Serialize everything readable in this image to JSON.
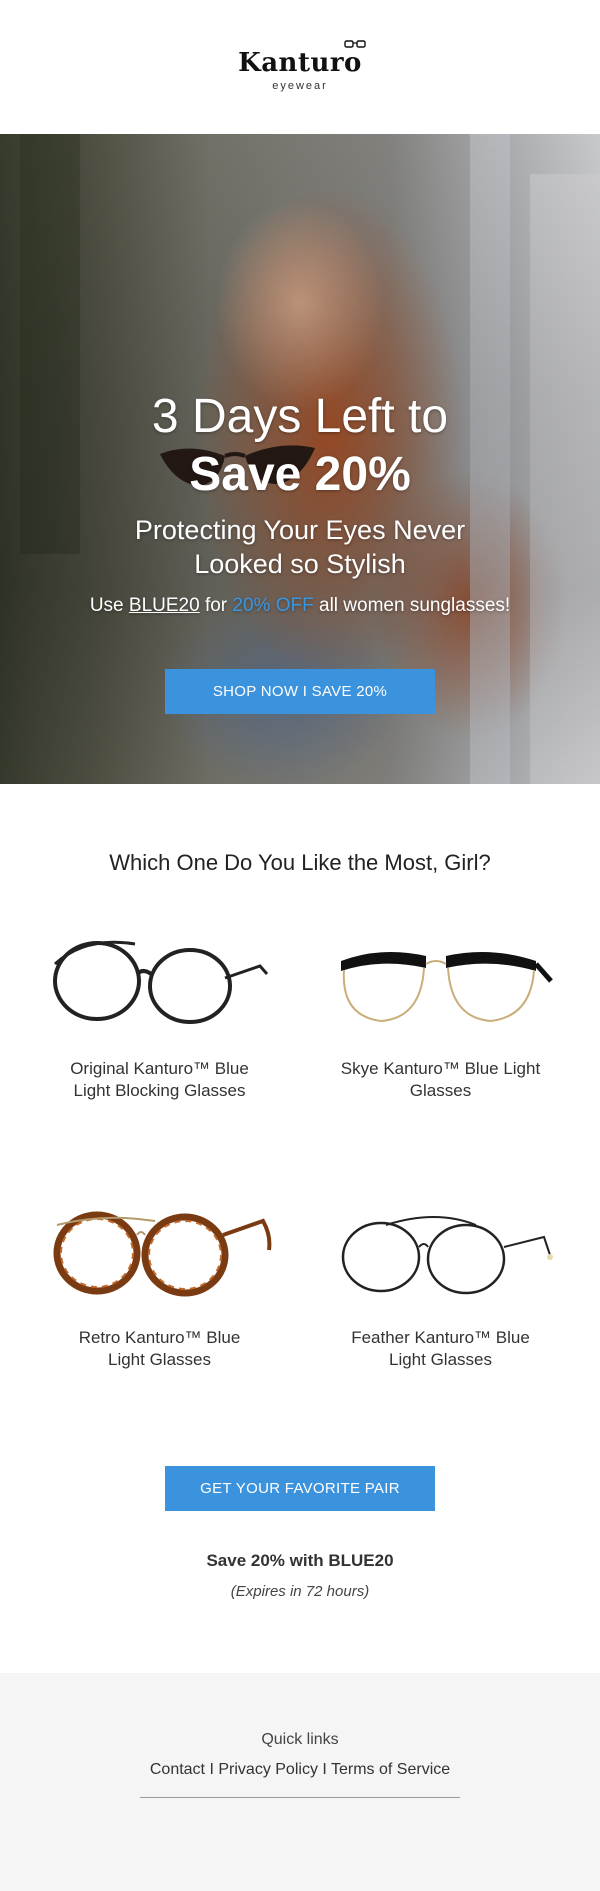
{
  "header": {
    "brand_name": "Kanturo",
    "brand_sub": "eyewear"
  },
  "hero": {
    "title_line1": "3 Days Left to",
    "title_line2": "Save 20%",
    "subtitle_line1": "Protecting Your Eyes Never",
    "subtitle_line2": "Looked so Stylish",
    "promo_prefix": "Use",
    "promo_code": "BLUE20",
    "promo_mid": "for",
    "promo_offer": "20% OFF",
    "promo_suffix": "all women sunglasses!",
    "button_label": "SHOP NOW I SAVE 20%"
  },
  "products": {
    "title": "Which One Do You Like the Most, Girl?",
    "items": [
      {
        "name": "Original Kanturo™ Blue Light Blocking Glasses",
        "icon": "round-black-glasses-icon"
      },
      {
        "name": "Skye Kanturo™ Blue Light Glasses",
        "icon": "browline-glasses-icon"
      },
      {
        "name": "Retro Kanturo™ Blue Light Glasses",
        "icon": "tortoise-glasses-icon"
      },
      {
        "name": "Feather Kanturo™ Blue Light Glasses",
        "icon": "wire-glasses-icon"
      }
    ],
    "button_label": "GET YOUR FAVORITE PAIR",
    "save_line": "Save 20% with BLUE20",
    "expire_line": "(Expires in 72 hours)"
  },
  "footer": {
    "title": "Quick links",
    "links": [
      "Contact",
      "Privacy Policy",
      "Terms of Service"
    ],
    "separator": "I"
  },
  "colors": {
    "accent": "#3b92dd",
    "footer_bg": "#f5f5f5"
  }
}
